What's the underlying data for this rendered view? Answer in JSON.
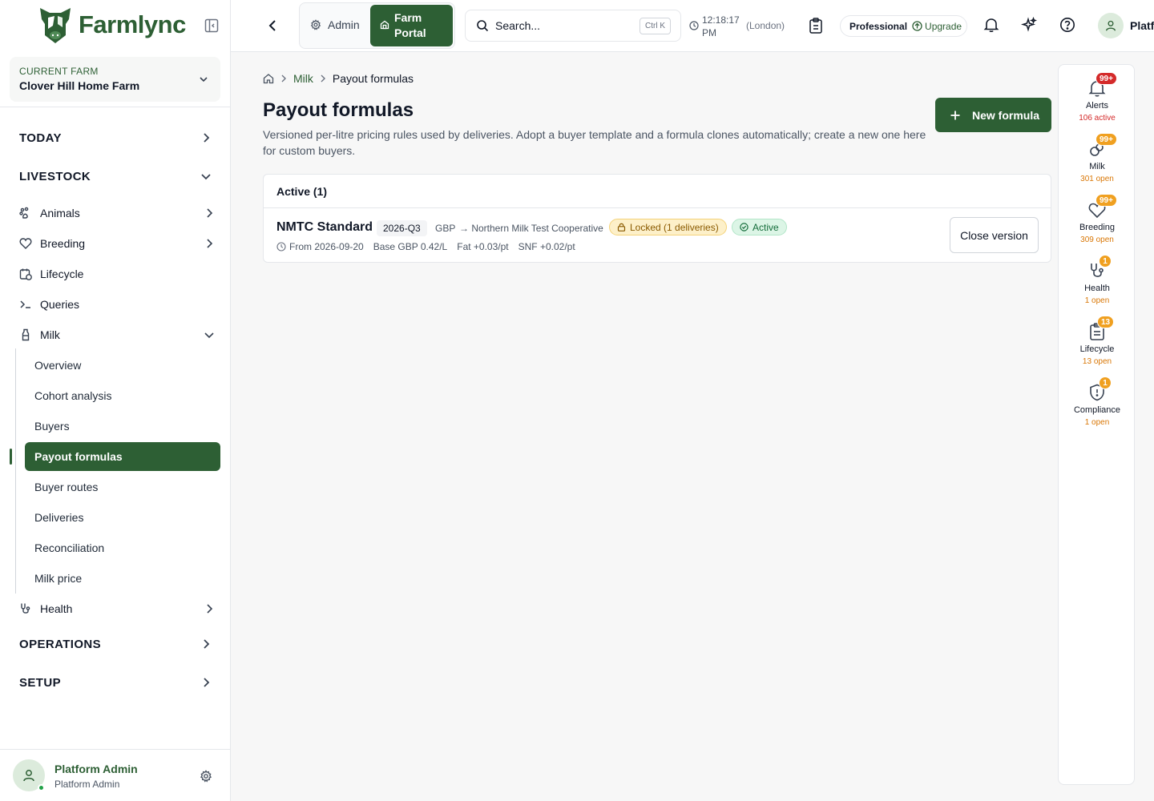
{
  "brand": {
    "name": "Farmlync"
  },
  "farm": {
    "label": "CURRENT FARM",
    "name": "Clover Hill Home Farm"
  },
  "nav": {
    "today": "TODAY",
    "livestock": "LIVESTOCK",
    "animals": "Animals",
    "breeding": "Breeding",
    "lifecycle": "Lifecycle",
    "queries": "Queries",
    "milk": "Milk",
    "milk_items": [
      "Overview",
      "Cohort analysis",
      "Buyers",
      "Payout formulas",
      "Buyer routes",
      "Deliveries",
      "Reconciliation",
      "Milk price"
    ],
    "health": "Health",
    "operations": "OPERATIONS",
    "setup": "SETUP"
  },
  "user": {
    "name": "Platform Admin",
    "role": "Platform Admin"
  },
  "topbar": {
    "admin_label": "Admin",
    "farm_portal_label": "Farm Portal",
    "search_placeholder": "Search...",
    "search_shortcut": "Ctrl K",
    "time": "12:18:17 PM",
    "timezone": "(London)",
    "plan": "Professional",
    "upgrade": "Upgrade",
    "user_short": "Platf"
  },
  "breadcrumb": {
    "milk": "Milk",
    "current": "Payout formulas"
  },
  "page": {
    "title": "Payout formulas",
    "description": "Versioned per-litre pricing rules used by deliveries. Adopt a buyer template and a formula clones automatically; create a new one here for custom buyers.",
    "new_button": "New formula"
  },
  "active_section": {
    "header": "Active (1)",
    "formula": {
      "name": "NMTC Standard",
      "version": "2026-Q3",
      "currency": "GBP",
      "buyer": "→ Northern Milk Test Cooperative",
      "locked": "Locked (1 deliveries)",
      "status": "Active",
      "from": "From 2026-09-20",
      "base": "Base GBP 0.42/L",
      "fat": "Fat +0.03/pt",
      "snf": "SNF +0.02/pt",
      "close_button": "Close version"
    }
  },
  "rail": [
    {
      "label": "Alerts",
      "badge": "99+",
      "count": "106 active",
      "icon": "bell-icon",
      "color": "#d42a2a"
    },
    {
      "label": "Milk",
      "badge": "99+",
      "count": "301 open",
      "icon": "droplets-icon",
      "color": "#f0a020"
    },
    {
      "label": "Breeding",
      "badge": "99+",
      "count": "309 open",
      "icon": "heart-icon",
      "color": "#f0a020"
    },
    {
      "label": "Health",
      "badge": "1",
      "count": "1 open",
      "icon": "stethoscope-icon",
      "color": "#f0a020"
    },
    {
      "label": "Lifecycle",
      "badge": "13",
      "count": "13 open",
      "icon": "clipboard-icon",
      "color": "#f0a020"
    },
    {
      "label": "Compliance",
      "badge": "1",
      "count": "1 open",
      "icon": "shield-alert-icon",
      "color": "#f0a020"
    }
  ],
  "colors": {
    "brand": "#2d5f34",
    "alert": "#d42a2a",
    "warning": "#f0a020"
  }
}
